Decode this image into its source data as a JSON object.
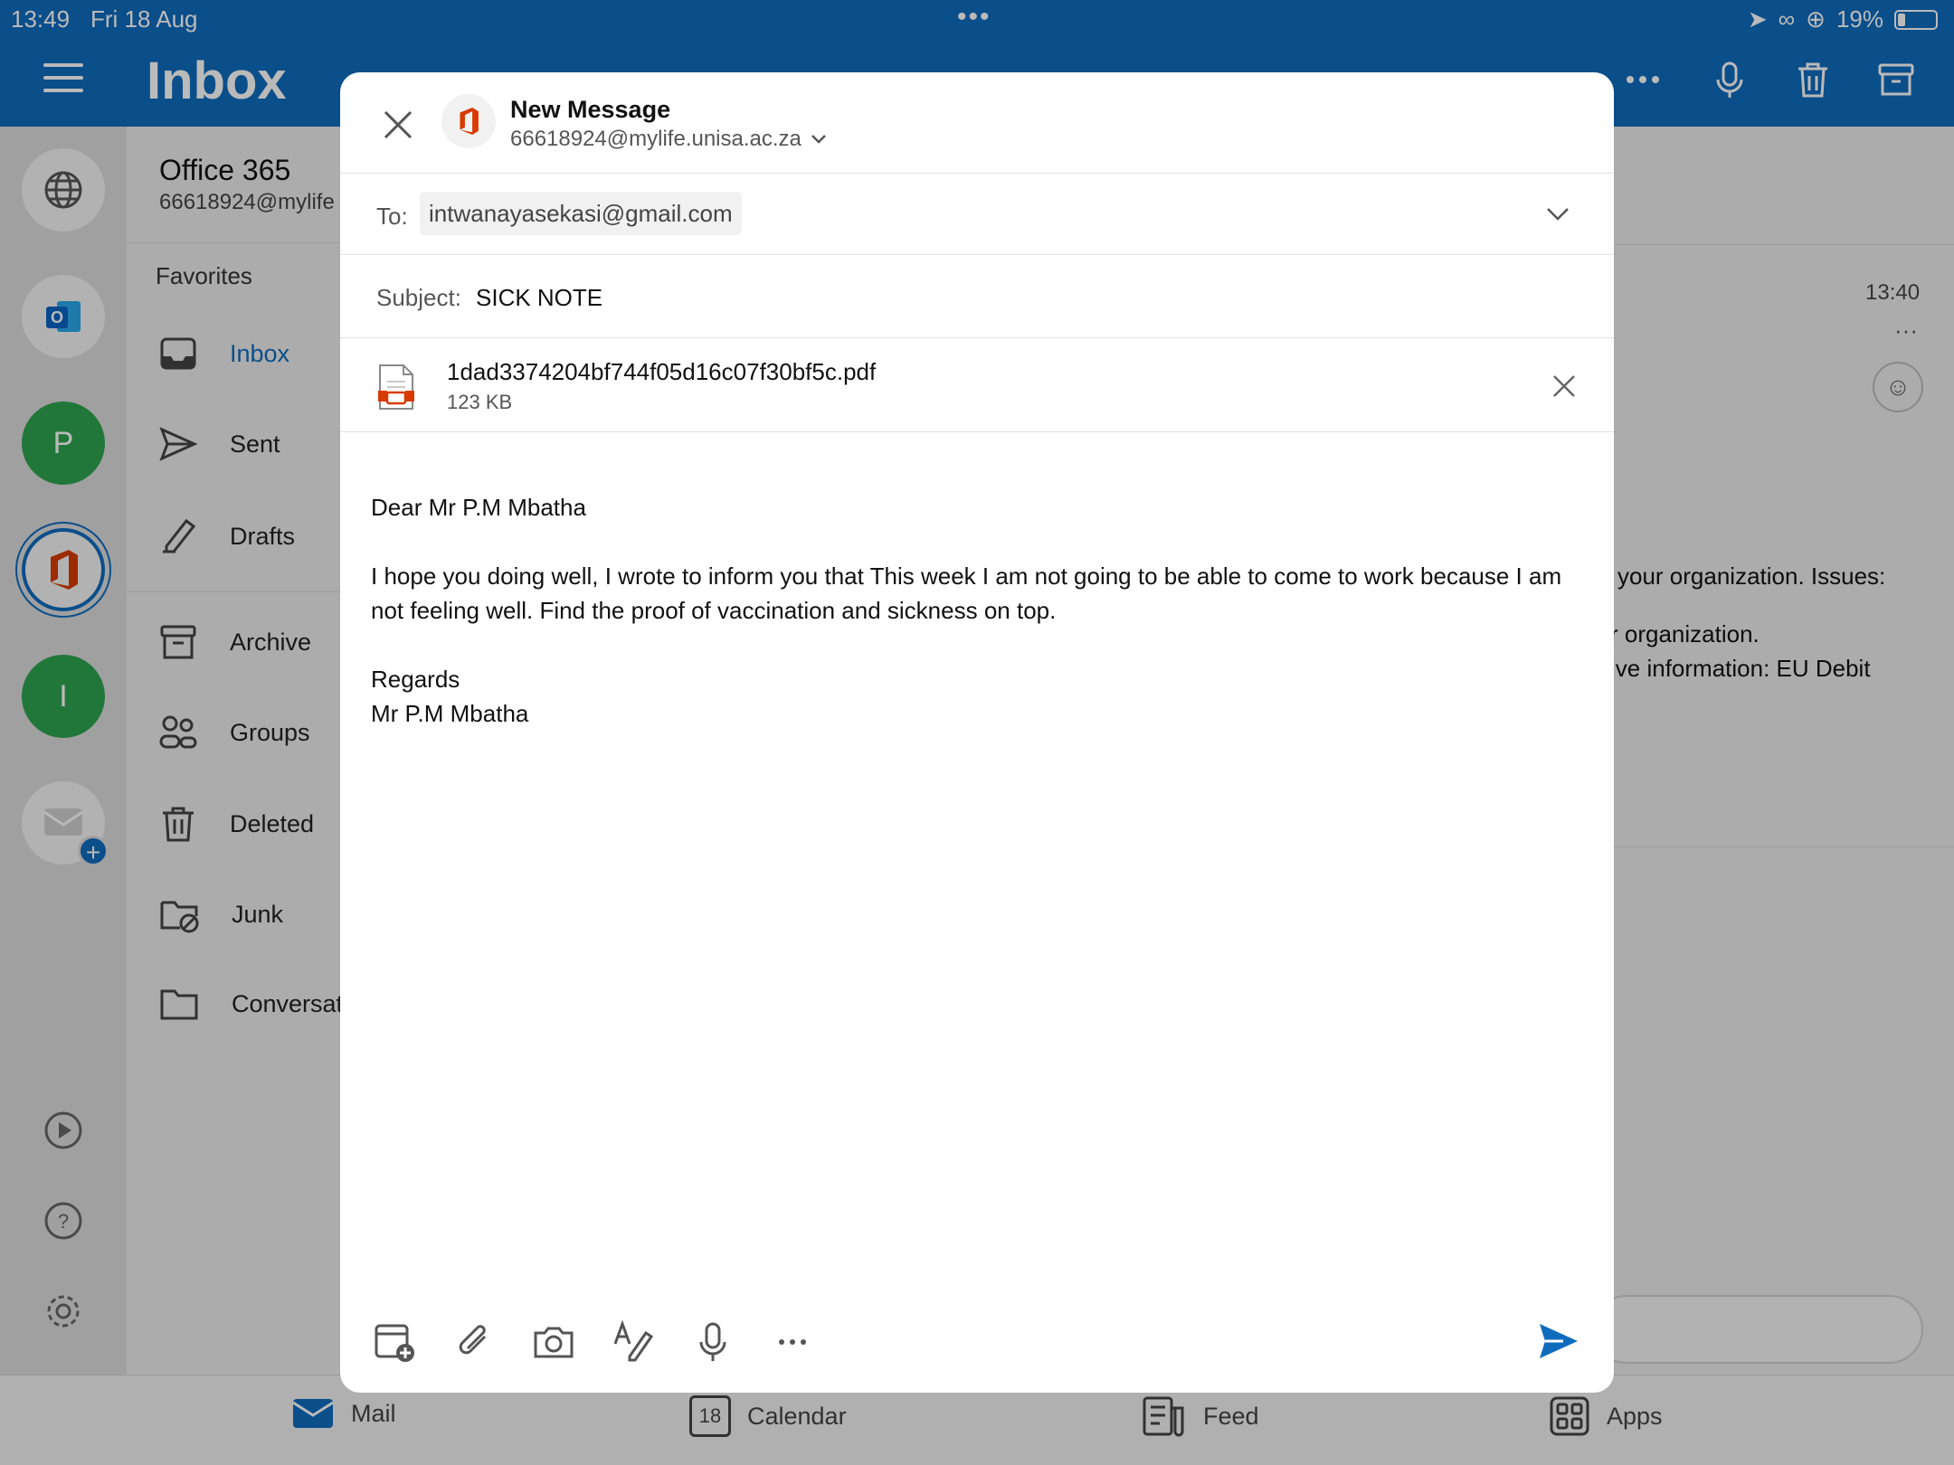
{
  "status_bar": {
    "time": "13:49",
    "date": "Fri 18 Aug",
    "battery": "19%"
  },
  "header": {
    "title": "Inbox"
  },
  "account": {
    "name": "Office 365",
    "email": "66618924@mylife"
  },
  "rail": {
    "avatar_p": "P",
    "avatar_i": "I"
  },
  "folders": {
    "favorites_label": "Favorites",
    "items": [
      {
        "label": "Inbox"
      },
      {
        "label": "Sent"
      },
      {
        "label": "Drafts"
      },
      {
        "label": "Archive"
      },
      {
        "label": "Groups"
      },
      {
        "label": "Deleted"
      },
      {
        "label": "Junk"
      },
      {
        "label": "Conversat"
      }
    ]
  },
  "reading_pane": {
    "time": "13:40",
    "line1": "your organization. Issues:",
    "line2": "r organization.",
    "line3": "ive information: EU Debit"
  },
  "compose": {
    "title": "New Message",
    "from": "66618924@mylife.unisa.ac.za",
    "to_label": "To:",
    "to_value": "intwanayasekasi@gmail.com",
    "subject_label": "Subject:",
    "subject_value": "SICK NOTE",
    "attachment": {
      "name": "1dad3374204bf744f05d16c07f30bf5c.pdf",
      "size": "123 KB"
    },
    "body": {
      "greeting": "Dear Mr P.M Mbatha",
      "paragraph": "I hope you doing well, I wrote to inform you that This week I am not going to be able to come to work because I am not feeling well. Find the proof of vaccination and sickness on top.",
      "closing": "Regards",
      "signature": "Mr P.M Mbatha"
    }
  },
  "tabs": [
    {
      "label": "Mail"
    },
    {
      "label": "Calendar",
      "day": "18"
    },
    {
      "label": "Feed"
    },
    {
      "label": "Apps"
    }
  ],
  "colors": {
    "brand": "#0f6cbd",
    "office_red": "#d83b01",
    "green_avatar": "#2ea44f"
  }
}
